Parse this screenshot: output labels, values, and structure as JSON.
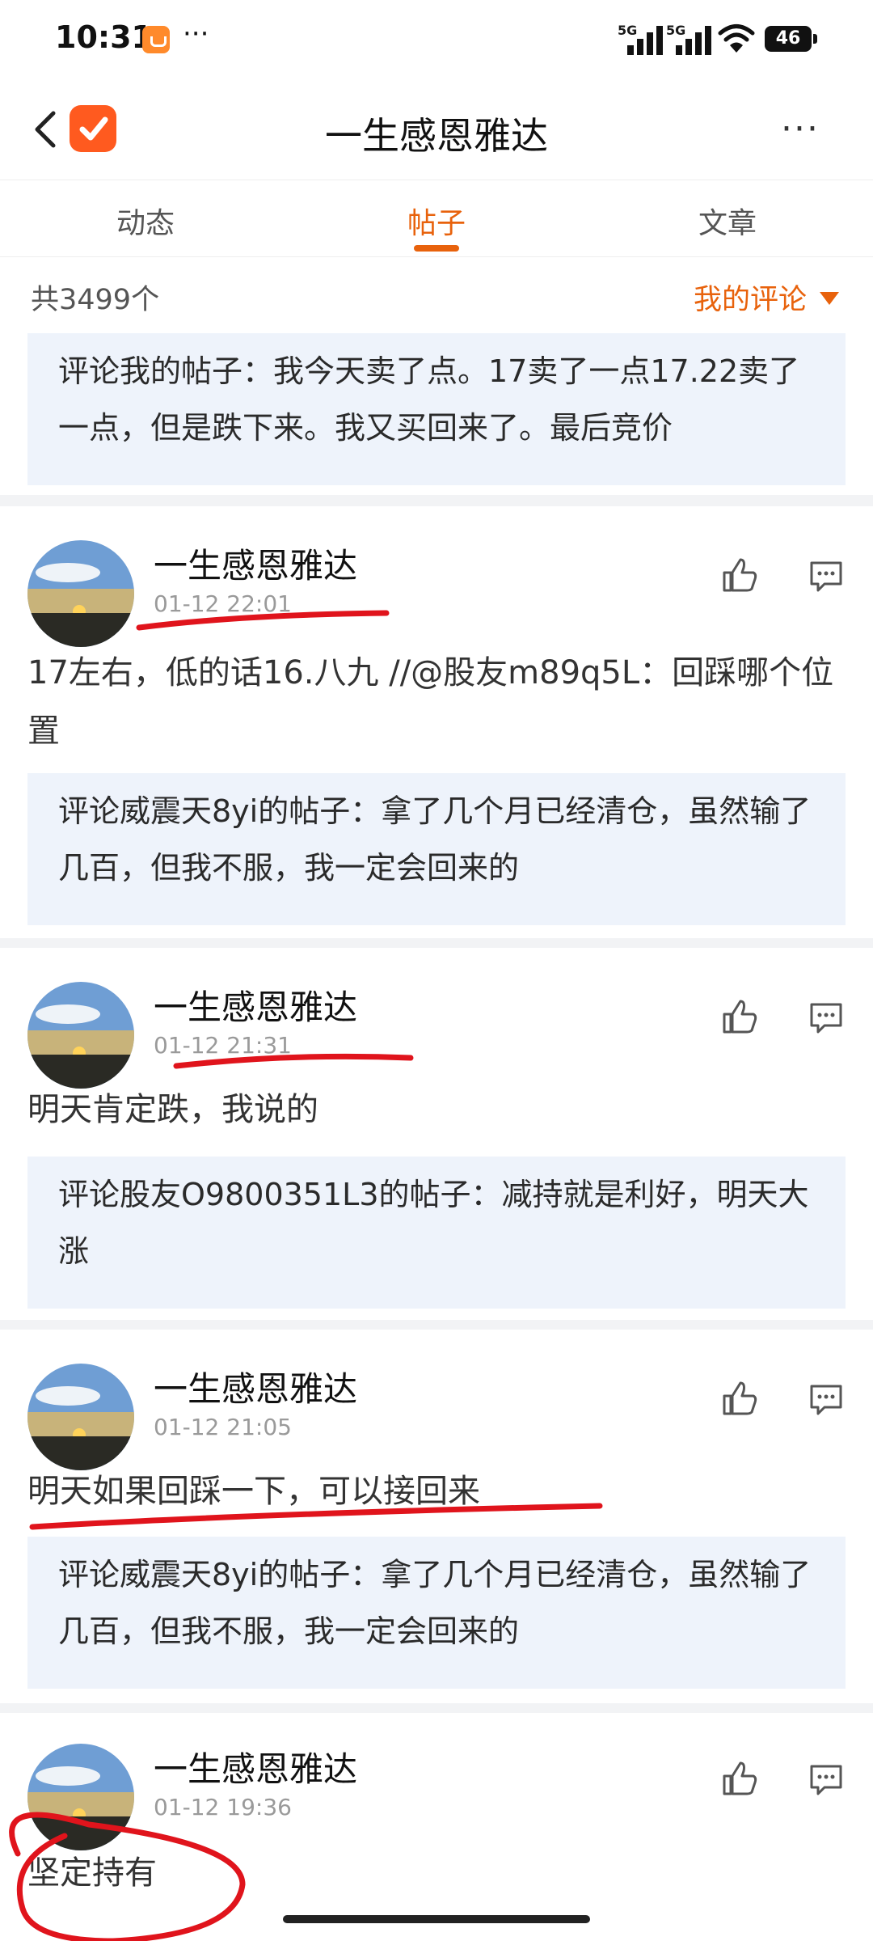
{
  "status_bar": {
    "time": "10:31",
    "more": "···",
    "signal1": "5G",
    "signal2": "5G",
    "battery": "46"
  },
  "header": {
    "title": "一生感恩雅达",
    "more": "···"
  },
  "tabs": [
    {
      "label": "动态",
      "active": false
    },
    {
      "label": "帖子",
      "active": true
    },
    {
      "label": "文章",
      "active": false
    }
  ],
  "summary": {
    "count": "共3499个",
    "filter": "我的评论"
  },
  "top_quote": "评论我的帖子：我今天卖了点。17卖了一点17.22卖了一点，但是跌下来。我又买回来了。最后竞价",
  "posts": [
    {
      "author": "一生感恩雅达",
      "date": "01-12 22:01",
      "content": "17左右，低的话16.八九 //@股友m89q5L：回踩哪个位置",
      "quote": "评论威震天8yi的帖子：拿了几个月已经清仓，虽然输了几百，但我不服，我一定会回来的"
    },
    {
      "author": "一生感恩雅达",
      "date": "01-12 21:31",
      "content": "明天肯定跌，我说的",
      "quote": "评论股友O9800351L3的帖子：减持就是利好，明天大涨"
    },
    {
      "author": "一生感恩雅达",
      "date": "01-12 21:05",
      "content": "明天如果回踩一下，可以接回来",
      "quote": "评论威震天8yi的帖子：拿了几个月已经清仓，虽然输了几百，但我不服，我一定会回来的"
    },
    {
      "author": "一生感恩雅达",
      "date": "01-12 19:36",
      "content": "坚定持有",
      "quote": ""
    }
  ],
  "colors": {
    "accent": "#e8620c",
    "quote_bg": "#eef3fb",
    "annotation": "#e0141c"
  }
}
